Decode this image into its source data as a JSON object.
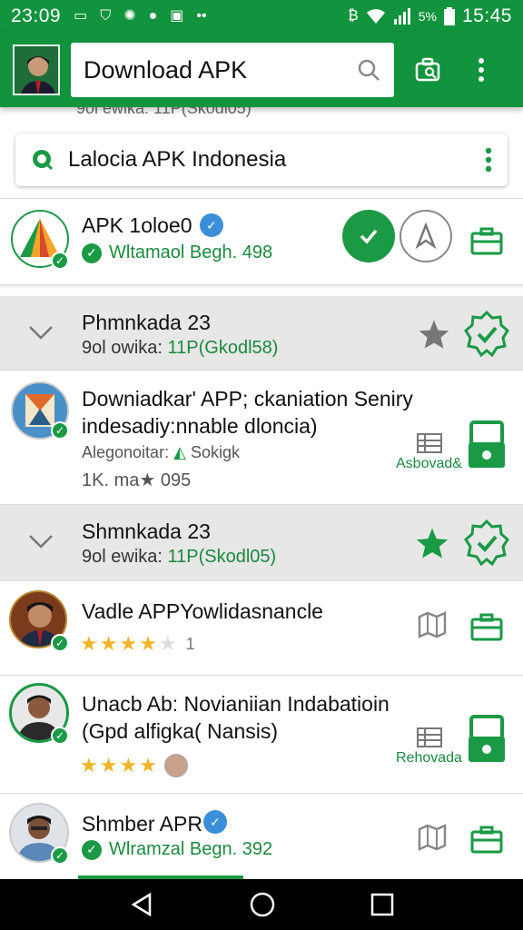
{
  "status_bar": {
    "time_left": "23:09",
    "battery_pct": "5%",
    "time_right": "15:45"
  },
  "app_bar": {
    "search_value": "Download APK"
  },
  "scroll_peek_text": "9ol ewika: 11P(Skodl05)",
  "search2": {
    "text": "Lalocia APK Indonesia"
  },
  "items": [
    {
      "title": "APK 1oloe0",
      "verified_text": "Wltamaol Begh. 498"
    },
    {
      "title": "Phmnkada 23",
      "sub_prefix": "9ol owika: ",
      "sub_green": "11P(Gkodl58)"
    },
    {
      "title_line1": "Downiadkar' APP; ckaniation Seniry",
      "title_line2": "indesadiy:nnable dloncia)",
      "meta": "Alegonoitar: ",
      "meta_extra": "Sokigk",
      "stats": "1K. ma★ 095",
      "action_label": "Asbovad&"
    },
    {
      "title": "Shmnkada 23",
      "sub_prefix": "9ol ewika: ",
      "sub_green": "11P(Skodl05)"
    },
    {
      "title": "Vadle APPYowlidasnancle",
      "rating_count": "1"
    },
    {
      "title_line1": "Unacb Ab: Novianiian Indabatioin",
      "title_line2": "(Gpd alfigka( Nansis)",
      "action_label": "Rehovada"
    },
    {
      "title": "Shmber APR",
      "verified_text": "Wlramzal Begn. 392"
    }
  ],
  "colors": {
    "brand": "#12933d",
    "accent_green": "#1a9a45",
    "star": "#f0b429"
  }
}
